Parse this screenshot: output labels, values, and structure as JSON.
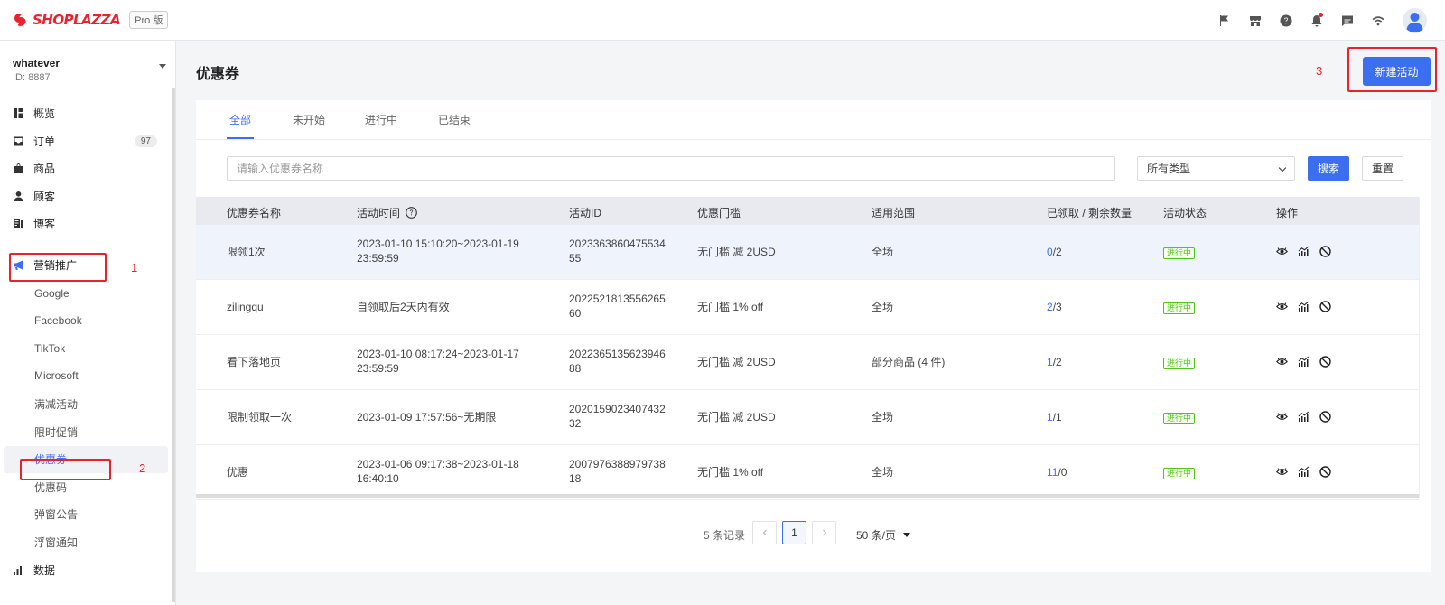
{
  "app": {
    "brand": "SHOPLAZZA",
    "edition": "Pro 版"
  },
  "store": {
    "name": "whatever",
    "id": "ID: 8887"
  },
  "sidebar": {
    "items": [
      {
        "label": "概览",
        "icon": "dashboard-icon"
      },
      {
        "label": "订单",
        "icon": "inbox-icon",
        "badge": "97"
      },
      {
        "label": "商品",
        "icon": "bag-icon"
      },
      {
        "label": "顾客",
        "icon": "person-icon"
      },
      {
        "label": "博客",
        "icon": "blog-icon"
      },
      {
        "label": "营销推广",
        "icon": "megaphone-icon"
      }
    ],
    "marketing_sub": [
      "Google",
      "Facebook",
      "TikTok",
      "Microsoft",
      "满减活动",
      "限时促销",
      "优惠券",
      "优惠码",
      "弹窗公告",
      "浮窗通知"
    ],
    "data_label": "数据"
  },
  "annotations": {
    "one": "1",
    "two": "2",
    "three": "3"
  },
  "page": {
    "title": "优惠券",
    "new_button": "新建活动"
  },
  "tabs": [
    "全部",
    "未开始",
    "进行中",
    "已结束"
  ],
  "filters": {
    "search_placeholder": "请输入优惠券名称",
    "type_selected": "所有类型",
    "search_button": "搜索",
    "reset_button": "重置"
  },
  "table": {
    "headers": [
      "优惠券名称",
      "活动时间",
      "活动ID",
      "优惠门槛",
      "适用范围",
      "已领取 / 剩余数量",
      "活动状态",
      "操作"
    ],
    "rows": [
      {
        "name": "限领1次",
        "time1": "2023-01-10 15:10:20~2023-01-19",
        "time2": "23:59:59",
        "id1": "2023363860475534",
        "id2": "55",
        "threshold": "无门槛 减 2USD",
        "scope": "全场",
        "claimed": "0",
        "remaining": "/2",
        "status": "进行中"
      },
      {
        "name": "zilingqu",
        "time1": "自领取后2天内有效",
        "time2": "",
        "id1": "2022521813556265",
        "id2": "60",
        "threshold": "无门槛 1% off",
        "scope": "全场",
        "claimed": "2",
        "remaining": "/3",
        "status": "进行中"
      },
      {
        "name": "看下落地页",
        "time1": "2023-01-10 08:17:24~2023-01-17",
        "time2": "23:59:59",
        "id1": "2022365135623946",
        "id2": "88",
        "threshold": "无门槛 减 2USD",
        "scope": "部分商品 (4 件)",
        "claimed": "1",
        "remaining": "/2",
        "status": "进行中"
      },
      {
        "name": "限制领取一次",
        "time1": "2023-01-09 17:57:56~无期限",
        "time2": "",
        "id1": "2020159023407432",
        "id2": "32",
        "threshold": "无门槛 减 2USD",
        "scope": "全场",
        "claimed": "1",
        "remaining": "/1",
        "status": "进行中"
      },
      {
        "name": "优惠",
        "time1": "2023-01-06 09:17:38~2023-01-18",
        "time2": "16:40:10",
        "id1": "2007976388979738",
        "id2": "18",
        "threshold": "无门槛 1% off",
        "scope": "全场",
        "claimed": "11",
        "remaining": "/0",
        "status": "进行中"
      }
    ]
  },
  "pagination": {
    "total": "5 条记录",
    "current_page": "1",
    "page_size": "50 条/页"
  },
  "colors": {
    "accent": "#3c6ef0",
    "brand_red": "#e8232e",
    "status_green": "#52c41a"
  }
}
